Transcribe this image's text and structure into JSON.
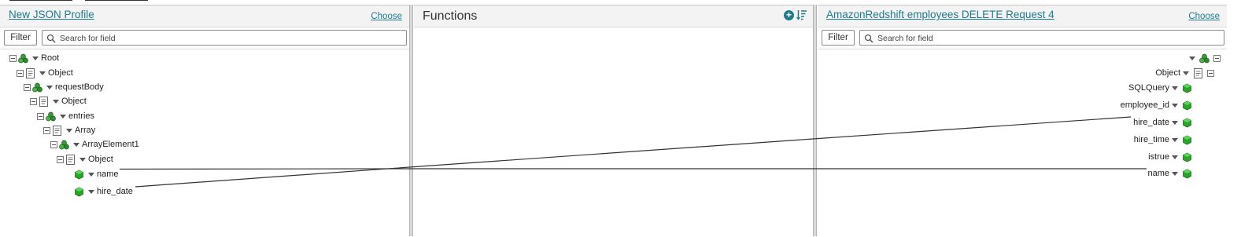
{
  "left_panel": {
    "title": "New JSON Profile",
    "choose_label": "Choose",
    "filter_label": "Filter",
    "search_placeholder": "Search for field",
    "tree": [
      {
        "label": "Root",
        "kind": "element-group",
        "collapsible": true
      },
      {
        "label": "Object",
        "kind": "object",
        "collapsible": true
      },
      {
        "label": "requestBody",
        "kind": "element-group",
        "collapsible": true
      },
      {
        "label": "Object",
        "kind": "object",
        "collapsible": true
      },
      {
        "label": "entries",
        "kind": "element-group",
        "collapsible": true
      },
      {
        "label": "Array",
        "kind": "object",
        "collapsible": true
      },
      {
        "label": "ArrayElement1",
        "kind": "element-group",
        "collapsible": true
      },
      {
        "label": "Object",
        "kind": "object",
        "collapsible": true
      },
      {
        "label": "name",
        "kind": "field",
        "collapsible": false
      },
      {
        "label": "hire_date",
        "kind": "field",
        "collapsible": false
      }
    ]
  },
  "functions_panel": {
    "title": "Functions",
    "add_icon": "add-circle-icon",
    "sort_icon": "sort-icon"
  },
  "right_panel": {
    "title": "AmazonRedshift employees DELETE Request 4",
    "choose_label": "Choose",
    "filter_label": "Filter",
    "search_placeholder": "Search for field",
    "tree": [
      {
        "label": "",
        "kind": "element-group",
        "collapsible": true
      },
      {
        "label": "Object",
        "kind": "object",
        "collapsible": true
      },
      {
        "label": "SQLQuery",
        "kind": "field",
        "collapsible": false
      },
      {
        "label": "employee_id",
        "kind": "field",
        "collapsible": false
      },
      {
        "label": "hire_date",
        "kind": "field",
        "collapsible": false
      },
      {
        "label": "hire_time",
        "kind": "field",
        "collapsible": false
      },
      {
        "label": "istrue",
        "kind": "field",
        "collapsible": false
      },
      {
        "label": "name",
        "kind": "field",
        "collapsible": false
      }
    ]
  },
  "mappings": [
    {
      "from": "name",
      "to": "name"
    },
    {
      "from": "hire_date",
      "to": "hire_date"
    }
  ],
  "colors": {
    "link": "#1f7a8c",
    "field_icon": "#2aa52a",
    "group_icon": "#3a9a3a",
    "line": "#333333"
  }
}
